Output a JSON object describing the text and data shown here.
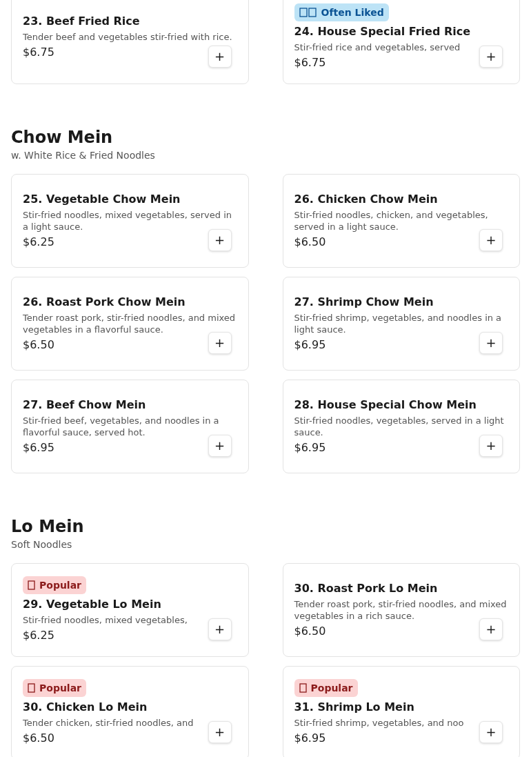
{
  "sections": [
    {
      "items": [
        {
          "title": "23. Beef Fried Rice",
          "description": "Tender beef and vegetables stir-fried with rice.",
          "price": "$6.75",
          "add_button": "+"
        },
        {
          "badge": {
            "kind": "often_liked",
            "label": "Often Liked"
          },
          "title": "24. House Special Fried Rice",
          "description": "Stir-fried rice and vegetables, served",
          "price": "$6.75",
          "add_button": "+"
        }
      ]
    },
    {
      "title": "Chow Mein",
      "subtitle": "w. White Rice & Fried Noodles",
      "items": [
        {
          "title": "25. Vegetable Chow Mein",
          "description": "Stir-fried noodles, mixed vegetables, served in a light sauce.",
          "price": "$6.25",
          "add_button": "+"
        },
        {
          "title": "26. Chicken Chow Mein",
          "description": "Stir-fried noodles, chicken, and vegetables, served in a light sauce.",
          "price": "$6.50",
          "add_button": "+"
        },
        {
          "title": "26. Roast Pork Chow Mein",
          "description": "Tender roast pork, stir-fried noodles, and mixed vegetables in a flavorful sauce.",
          "price": "$6.50",
          "add_button": "+"
        },
        {
          "title": "27. Shrimp Chow Mein",
          "description": "Stir-fried shrimp, vegetables, and noodles in a light sauce.",
          "price": "$6.95",
          "add_button": "+"
        },
        {
          "title": "27. Beef Chow Mein",
          "description": "Stir-fried beef, vegetables, and noodles in a flavorful sauce, served hot.",
          "price": "$6.95",
          "add_button": "+"
        },
        {
          "title": "28. House Special Chow Mein",
          "description": "Stir-fried noodles, vegetables, served in a light sauce.",
          "price": "$6.95",
          "add_button": "+"
        }
      ]
    },
    {
      "title": "Lo Mein",
      "subtitle": "Soft Noodles",
      "items": [
        {
          "badge": {
            "kind": "popular",
            "label": "Popular"
          },
          "title": "29. Vegetable Lo Mein",
          "description": "Stir-fried noodles, mixed vegetables,",
          "price": "$6.25",
          "add_button": "+"
        },
        {
          "title": "30. Roast Pork Lo Mein",
          "description": "Tender roast pork, stir-fried noodles, and mixed vegetables in a rich sauce.",
          "price": "$6.50",
          "add_button": "+"
        },
        {
          "badge": {
            "kind": "popular",
            "label": "Popular"
          },
          "title": "30. Chicken Lo Mein",
          "description": "Tender chicken, stir-fried noodles, and",
          "price": "$6.50",
          "add_button": "+"
        },
        {
          "badge": {
            "kind": "popular",
            "label": "Popular"
          },
          "title": "31. Shrimp Lo Mein",
          "description": "Stir-fried shrimp, vegetables, and noo",
          "price": "$6.95",
          "add_button": "+"
        }
      ]
    }
  ]
}
